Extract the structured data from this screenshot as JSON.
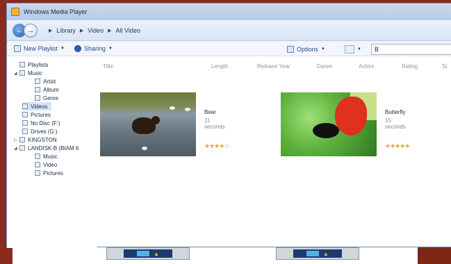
{
  "window": {
    "title": "Windows Media Player"
  },
  "nav": {
    "breadcrumb": [
      "Library",
      "Video",
      "All Video"
    ]
  },
  "toolbar": {
    "new_playlist": "New Playlist",
    "sharing": "Sharing",
    "options": "Options",
    "search_value": "B"
  },
  "columns": [
    "Title",
    "Length",
    "Release Year",
    "Genre",
    "Actors",
    "Rating",
    "Si"
  ],
  "sidebar": {
    "playlists": "Playlists",
    "music": "Music",
    "artist": "Artist",
    "album": "Album",
    "genre": "Genre",
    "videos": "Videos",
    "pictures": "Pictures",
    "no_disc": "No Disc (F:)",
    "drives": "Drives (G:)",
    "kingston": "KINGSTON",
    "landisk": "LANDISK-B (BIAM 6",
    "ld_music": "Music",
    "ld_video": "Video",
    "ld_pictures": "Pictures"
  },
  "items": [
    {
      "title": "Bear",
      "duration": "11 seconds",
      "rating": 4
    },
    {
      "title": "Butterfly",
      "duration": "15 seconds",
      "rating": 5
    }
  ],
  "icons": {
    "back": "back-arrow-icon",
    "forward": "forward-arrow-icon",
    "app": "media-player-icon"
  }
}
